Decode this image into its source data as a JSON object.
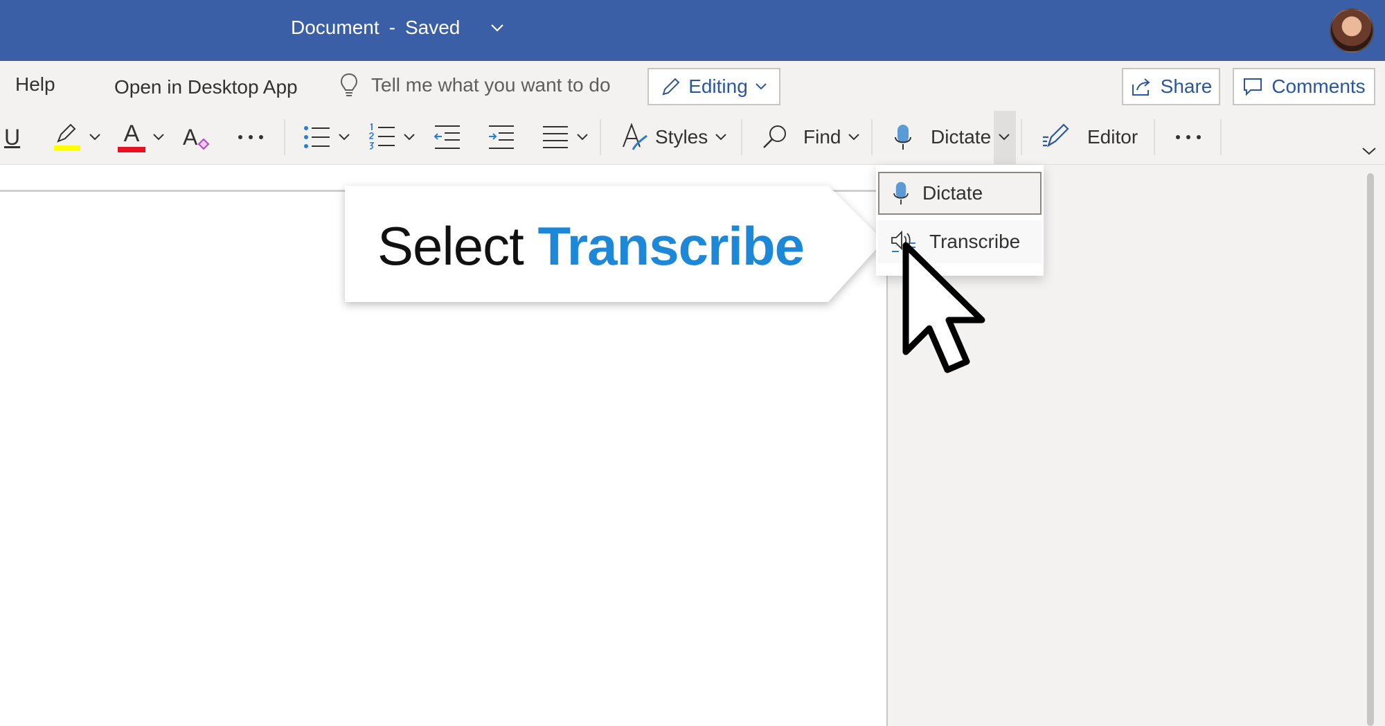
{
  "titlebar": {
    "doc_name": "Document",
    "separator": "-",
    "save_status": "Saved",
    "bg_color": "#3b5fa6"
  },
  "menu": {
    "help": "Help",
    "open_desktop": "Open in Desktop App",
    "tell_me_placeholder": "Tell me what you want to do",
    "editing": "Editing",
    "share": "Share",
    "comments": "Comments"
  },
  "ribbon": {
    "underline": "U",
    "font_color_letter": "A",
    "clear_format_letter": "A",
    "styles": "Styles",
    "find": "Find",
    "dictate": "Dictate",
    "editor": "Editor"
  },
  "callout": {
    "prefix": "Select",
    "highlight": "Transcribe"
  },
  "dictate_menu": {
    "items": [
      {
        "label": "Dictate",
        "icon": "microphone-icon"
      },
      {
        "label": "Transcribe",
        "icon": "transcribe-icon"
      }
    ]
  },
  "colors": {
    "accent": "#2b579a",
    "highlight_yellow": "#ffff00",
    "font_red": "#e81123",
    "callout_blue": "#1e88d8"
  }
}
